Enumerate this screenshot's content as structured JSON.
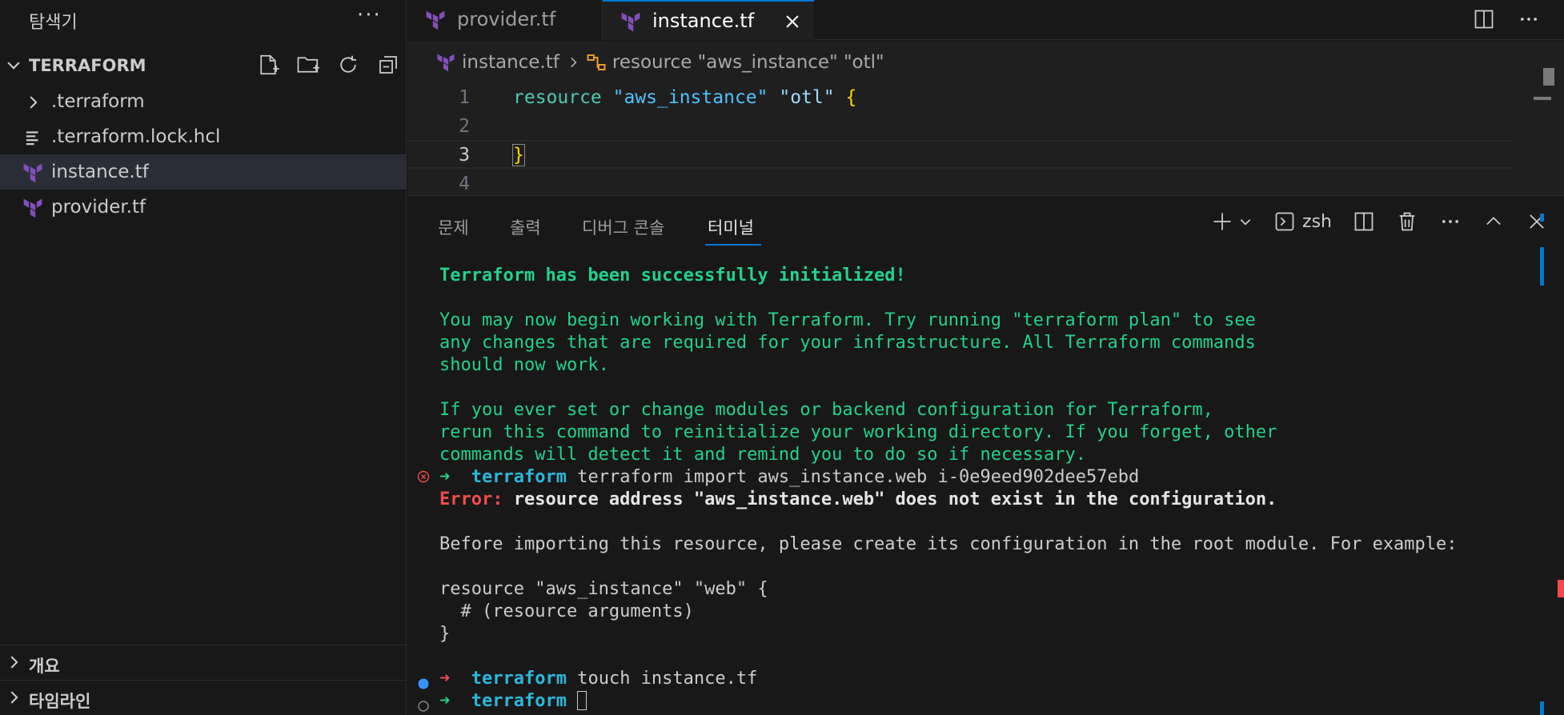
{
  "sidebar": {
    "title": "탐색기",
    "more": "···",
    "section": "TERRAFORM",
    "items": [
      {
        "label": ".terraform",
        "icon": "folder-chevron-icon"
      },
      {
        "label": ".terraform.lock.hcl",
        "icon": "lines-file-icon"
      },
      {
        "label": "instance.tf",
        "icon": "terraform-icon",
        "selected": true
      },
      {
        "label": "provider.tf",
        "icon": "terraform-icon"
      }
    ],
    "outline": "개요",
    "timeline": "타임라인"
  },
  "tabs": [
    {
      "label": "provider.tf",
      "active": false
    },
    {
      "label": "instance.tf",
      "active": true
    }
  ],
  "editor": {
    "breadcrumb_file": "instance.tf",
    "breadcrumb_symbol": "resource \"aws_instance\" \"otl\"",
    "lines": [
      {
        "num": "1",
        "kw": "resource",
        "s1": " \"aws_instance\"",
        "s2": " \"otl\"",
        "tail": " {"
      },
      {
        "num": "2"
      },
      {
        "num": "3",
        "tail": "}"
      },
      {
        "num": "4"
      }
    ]
  },
  "panel": {
    "tabs": [
      "문제",
      "출력",
      "디버그 콘솔",
      "터미널"
    ],
    "active_tab": "터미널",
    "shell": "zsh",
    "terminal": {
      "init_title": "Terraform has been successfully initialized!",
      "para1": [
        "You may now begin working with Terraform. Try running \"terraform plan\" to see",
        "any changes that are required for your infrastructure. All Terraform commands",
        "should now work."
      ],
      "para2": [
        "If you ever set or change modules or backend configuration for Terraform,",
        "rerun this command to reinitialize your working directory. If you forget, other",
        "commands will detect it and remind you to do so if necessary."
      ],
      "cmd1_dir": "terraform",
      "cmd1": " terraform import aws_instance.web i-0e9eed902dee57ebd",
      "error_label": "Error:",
      "error_msg": " resource address \"aws_instance.web\" does not exist in the configuration.",
      "before": "Before importing this resource, please create its configuration in the root module. For example:",
      "example": [
        "resource \"aws_instance\" \"web\" {",
        "  # (resource arguments)",
        "}"
      ],
      "cmd2_dir": "terraform",
      "cmd2": " touch instance.tf",
      "cmd3_dir": "terraform",
      "prompt_arrow": "➜"
    }
  },
  "colors": {
    "accent": "#0078d4",
    "terraform": "#844fba",
    "success": "#23d18b",
    "error": "#f14c4c",
    "dir": "#29b8db"
  }
}
